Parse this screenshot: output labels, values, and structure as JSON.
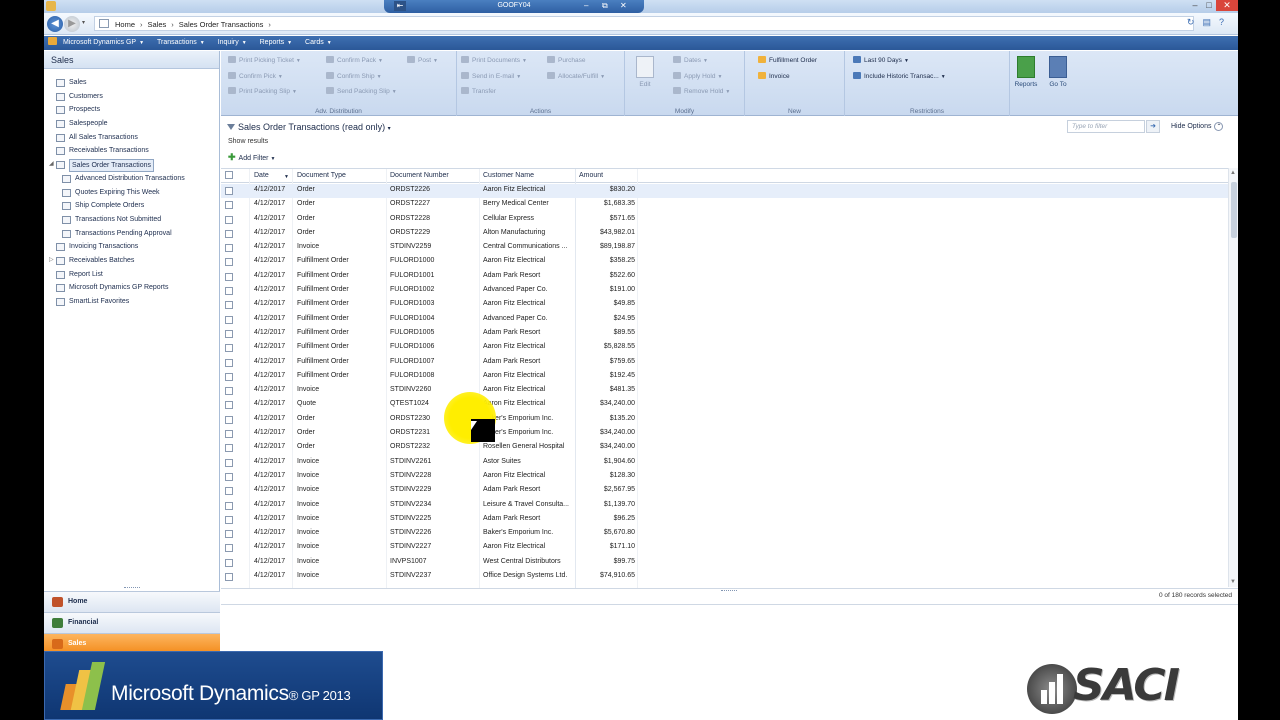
{
  "window": {
    "title": "GOOFY04"
  },
  "address": {
    "crumbs": [
      "Home",
      "Sales",
      "Sales Order Transactions"
    ]
  },
  "menubar": {
    "items": [
      "Microsoft Dynamics GP",
      "Transactions",
      "Inquiry",
      "Reports",
      "Cards"
    ]
  },
  "leftnav": {
    "header": "Sales",
    "items": [
      {
        "label": "Sales",
        "indent": 0
      },
      {
        "label": "Customers",
        "indent": 0
      },
      {
        "label": "Prospects",
        "indent": 0
      },
      {
        "label": "Salespeople",
        "indent": 0
      },
      {
        "label": "All Sales Transactions",
        "indent": 0
      },
      {
        "label": "Receivables Transactions",
        "indent": 0
      },
      {
        "label": "Sales Order Transactions",
        "indent": 0,
        "selected": true,
        "expander": "◢"
      },
      {
        "label": "Advanced Distribution Transactions",
        "indent": 1
      },
      {
        "label": "Quotes Expiring This Week",
        "indent": 1
      },
      {
        "label": "Ship Complete Orders",
        "indent": 1
      },
      {
        "label": "Transactions Not Submitted",
        "indent": 1
      },
      {
        "label": "Transactions Pending Approval",
        "indent": 1
      },
      {
        "label": "Invoicing Transactions",
        "indent": 0
      },
      {
        "label": "Receivables Batches",
        "indent": 0,
        "expander": "▷"
      },
      {
        "label": "Report List",
        "indent": 0
      },
      {
        "label": "Microsoft Dynamics GP Reports",
        "indent": 0
      },
      {
        "label": "SmartList Favorites",
        "indent": 0
      }
    ],
    "nav_buttons": [
      {
        "label": "Home",
        "color": "#c0522a"
      },
      {
        "label": "Financial",
        "color": "#3f7d3a"
      },
      {
        "label": "Sales",
        "color": "#d86a1a",
        "active": true
      }
    ]
  },
  "ribbon": {
    "groups": [
      {
        "label": "Adv. Distribution",
        "buttons": [
          "Print Picking Ticket",
          "Confirm Pack",
          "Confirm Pick",
          "Confirm Ship",
          "Print Packing Slip",
          "Send Packing Slip"
        ]
      },
      {
        "label": "Actions",
        "buttons": [
          "Post",
          "Print Documents",
          "Purchase",
          "Send in E-mail",
          "Allocate/Fulfill",
          "Transfer"
        ]
      },
      {
        "label": "Modify",
        "buttons": [
          "Edit",
          "Dates",
          "Apply Hold",
          "Remove Hold"
        ]
      },
      {
        "label": "New",
        "buttons": [
          "Fulfillment Order",
          "Invoice"
        ]
      },
      {
        "label": "Restrictions",
        "buttons": [
          "Last 90 Days",
          "Include Historic Transac..."
        ]
      },
      {
        "label": "",
        "buttons": [
          "Reports",
          "Go To"
        ]
      }
    ]
  },
  "list": {
    "title": "Sales Order Transactions (read only)",
    "show_results": "Show results",
    "add_filter": "Add Filter",
    "filter_placeholder": "Type to filter",
    "hide_options": "Hide Options",
    "columns": [
      "Date",
      "Document Type",
      "Document Number",
      "Customer Name",
      "Amount"
    ],
    "rows": [
      [
        "4/12/2017",
        "Order",
        "ORDST2226",
        "Aaron Fitz Electrical",
        "$830.20"
      ],
      [
        "4/12/2017",
        "Order",
        "ORDST2227",
        "Berry Medical Center",
        "$1,683.35"
      ],
      [
        "4/12/2017",
        "Order",
        "ORDST2228",
        "Cellular Express",
        "$571.65"
      ],
      [
        "4/12/2017",
        "Order",
        "ORDST2229",
        "Alton Manufacturing",
        "$43,982.01"
      ],
      [
        "4/12/2017",
        "Invoice",
        "STDINV2259",
        "Central Communications ...",
        "$89,198.87"
      ],
      [
        "4/12/2017",
        "Fulfillment Order",
        "FULORD1000",
        "Aaron Fitz Electrical",
        "$358.25"
      ],
      [
        "4/12/2017",
        "Fulfillment Order",
        "FULORD1001",
        "Adam Park Resort",
        "$522.60"
      ],
      [
        "4/12/2017",
        "Fulfillment Order",
        "FULORD1002",
        "Advanced Paper Co.",
        "$191.00"
      ],
      [
        "4/12/2017",
        "Fulfillment Order",
        "FULORD1003",
        "Aaron Fitz Electrical",
        "$49.85"
      ],
      [
        "4/12/2017",
        "Fulfillment Order",
        "FULORD1004",
        "Advanced Paper Co.",
        "$24.95"
      ],
      [
        "4/12/2017",
        "Fulfillment Order",
        "FULORD1005",
        "Adam Park Resort",
        "$89.55"
      ],
      [
        "4/12/2017",
        "Fulfillment Order",
        "FULORD1006",
        "Aaron Fitz Electrical",
        "$5,828.55"
      ],
      [
        "4/12/2017",
        "Fulfillment Order",
        "FULORD1007",
        "Adam Park Resort",
        "$759.65"
      ],
      [
        "4/12/2017",
        "Fulfillment Order",
        "FULORD1008",
        "Aaron Fitz Electrical",
        "$192.45"
      ],
      [
        "4/12/2017",
        "Invoice",
        "STDINV2260",
        "Aaron Fitz Electrical",
        "$481.35"
      ],
      [
        "4/12/2017",
        "Quote",
        "QTEST1024",
        "Aaron Fitz Electrical",
        "$34,240.00"
      ],
      [
        "4/12/2017",
        "Order",
        "ORDST2230",
        "Baker's Emporium Inc.",
        "$135.20"
      ],
      [
        "4/12/2017",
        "Order",
        "ORDST2231",
        "Baker's Emporium Inc.",
        "$34,240.00"
      ],
      [
        "4/12/2017",
        "Order",
        "ORDST2232",
        "Rosellen General Hospital",
        "$34,240.00"
      ],
      [
        "4/12/2017",
        "Invoice",
        "STDINV2261",
        "Astor Suites",
        "$1,904.60"
      ],
      [
        "4/12/2017",
        "Invoice",
        "STDINV2228",
        "Aaron Fitz Electrical",
        "$128.30"
      ],
      [
        "4/12/2017",
        "Invoice",
        "STDINV2229",
        "Adam Park Resort",
        "$2,567.95"
      ],
      [
        "4/12/2017",
        "Invoice",
        "STDINV2234",
        "Leisure & Travel Consulta...",
        "$1,139.70"
      ],
      [
        "4/12/2017",
        "Invoice",
        "STDINV2225",
        "Adam Park Resort",
        "$96.25"
      ],
      [
        "4/12/2017",
        "Invoice",
        "STDINV2226",
        "Baker's Emporium Inc.",
        "$5,670.80"
      ],
      [
        "4/12/2017",
        "Invoice",
        "STDINV2227",
        "Aaron Fitz Electrical",
        "$171.10"
      ],
      [
        "4/12/2017",
        "Invoice",
        "INVPS1007",
        "West Central Distributors",
        "$99.75"
      ],
      [
        "4/12/2017",
        "Invoice",
        "STDINV2237",
        "Office Design Systems Ltd.",
        "$74,910.65"
      ]
    ],
    "records_status": "0 of 180 records selected"
  },
  "branding": {
    "ms_logo_text": "Microsoft Dynamics",
    "ms_logo_version": "GP 2013",
    "saci_text": "SACI"
  },
  "colors": {
    "menubar": "#2f5e9e",
    "active_nav": "#f38b1b",
    "row_highlight": "#e6eefa",
    "cursor_highlight": "#ffee00"
  }
}
